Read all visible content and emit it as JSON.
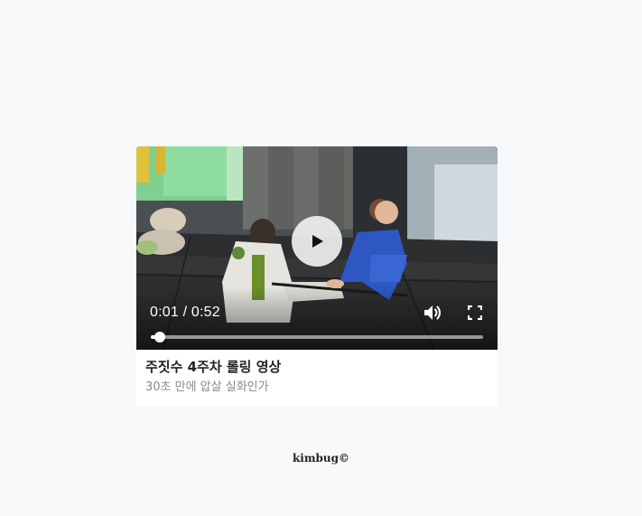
{
  "video": {
    "current_time": "0:01",
    "duration": "0:52",
    "progress": 0.026,
    "colors": {
      "control": "#ffffff",
      "play_button_bg": "#f0f0f0"
    },
    "icons": {
      "play": "play-icon",
      "volume": "volume-icon",
      "fullscreen": "fullscreen-icon"
    }
  },
  "card": {
    "title": "주짓수 4주차 롤링 영상",
    "subtitle": "30초 만에 압살 실화인가"
  },
  "footer": {
    "text": "kimbug©"
  }
}
